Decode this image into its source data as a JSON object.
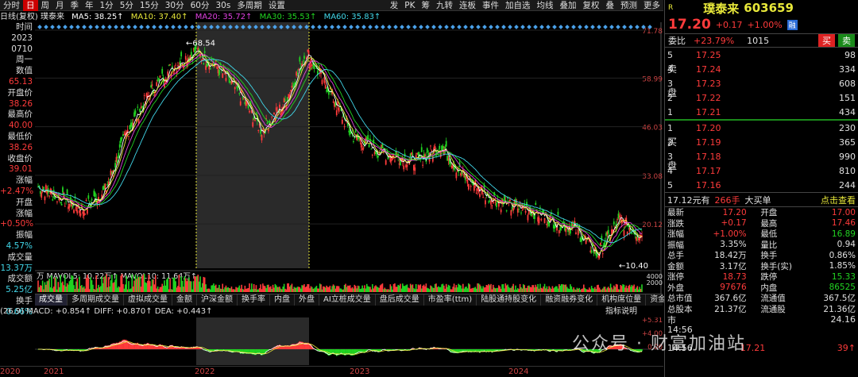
{
  "toolbar": {
    "items": [
      "分时",
      "日",
      "周",
      "月",
      "季",
      "年",
      "1分",
      "5分",
      "15分",
      "30分",
      "60分",
      "30s",
      "多周期",
      "设置"
    ],
    "active_index": 1,
    "right_items": [
      "发",
      "PK",
      "筹",
      "九转",
      "连板",
      "事件",
      "加自选",
      "均线",
      "叠加",
      "复权",
      "叠",
      "预测",
      "更多"
    ]
  },
  "legend": {
    "title": "日线(复权) 璞泰来",
    "ma5": "MA5: 38.25↑",
    "ma10": "MA10: 37.40↑",
    "ma20": "MA20: 35.72↑",
    "ma30": "MA30: 35.53↑",
    "ma60": "MA60: 35.83↑"
  },
  "left_panel": [
    {
      "label": "时间",
      "value": ""
    },
    {
      "label": "2023",
      "value": ""
    },
    {
      "label": "0710",
      "value": ""
    },
    {
      "label": "周一",
      "value": ""
    },
    {
      "label": "数值",
      "value": ""
    },
    {
      "label": "65.13",
      "value": "",
      "cls": "red"
    },
    {
      "label": "开盘价",
      "value": ""
    },
    {
      "label": "38.26",
      "value": "",
      "cls": "red"
    },
    {
      "label": "最高价",
      "value": ""
    },
    {
      "label": "40.00",
      "value": "",
      "cls": "red"
    },
    {
      "label": "最低价",
      "value": ""
    },
    {
      "label": "38.26",
      "value": "",
      "cls": "red"
    },
    {
      "label": "收盘价",
      "value": ""
    },
    {
      "label": "39.01",
      "value": "",
      "cls": "red"
    },
    {
      "label": "涨幅",
      "value": ""
    },
    {
      "label": "+2.47%",
      "value": "",
      "cls": "red"
    },
    {
      "label": "开盘",
      "value": ""
    },
    {
      "label": "涨幅",
      "value": ""
    },
    {
      "label": "+0.50%",
      "value": "",
      "cls": "red"
    },
    {
      "label": "振幅",
      "value": ""
    },
    {
      "label": "4.57%",
      "value": "",
      "cls": "cyan"
    },
    {
      "label": "成交量",
      "value": ""
    },
    {
      "label": "13.37万",
      "value": "",
      "cls": "cyan"
    },
    {
      "label": "成交额",
      "value": ""
    },
    {
      "label": "5.25亿",
      "value": "",
      "cls": "cyan"
    },
    {
      "label": "换手",
      "value": ""
    },
    {
      "label": "0.66%",
      "value": "",
      "cls": "cyan"
    }
  ],
  "price_axis": [
    "71.78",
    "58.99",
    "46.03",
    "33.08",
    "20.12"
  ],
  "annotations": {
    "high": "68.54",
    "low": "10.40"
  },
  "volume_legend": "万 MAVOL5: 10.22万↑ MAVOL10: 11.64万↑",
  "volume_axis": [
    "4000",
    "2000"
  ],
  "tabs": [
    "多周期成交量",
    "虚拟成交量",
    "金额",
    "沪深金额",
    "换手率",
    "内盘",
    "外盘",
    "AI立桩成交量",
    "盘后成交量",
    "市盈率(ttm)",
    "陆股通持股变化",
    "融资融券变化",
    "机构席位量",
    "资金抄底"
  ],
  "tab_prefix": "成交量",
  "macd": {
    "label": "(26,9) MACD: +0.854↑ DIFF: +0.870↑ DEA: +0.443↑",
    "axis": [
      "+5.31",
      "+4.00",
      "0.00"
    ],
    "explain": "指标说明"
  },
  "years": [
    "2020",
    "2021",
    "2022",
    "2023",
    "2024"
  ],
  "right": {
    "header_r": "R",
    "name": "璞泰来",
    "code": "603659",
    "price": "17.20",
    "change": "+0.17",
    "pct": "+1.00%",
    "tag": "融",
    "weibi_label": "委比",
    "weibi": "+23.79%",
    "weicha": "1015",
    "buy_btn": "买",
    "sell_btn": "卖",
    "sell_label": "卖盘",
    "buy_label": "买盘",
    "asks": [
      {
        "lvl": "5",
        "price": "17.25",
        "vol": "98"
      },
      {
        "lvl": "4",
        "price": "17.24",
        "vol": "334"
      },
      {
        "lvl": "3",
        "price": "17.23",
        "vol": "608"
      },
      {
        "lvl": "2",
        "price": "17.22",
        "vol": "151"
      },
      {
        "lvl": "1",
        "price": "17.21",
        "vol": "434"
      }
    ],
    "bids": [
      {
        "lvl": "1",
        "price": "17.20",
        "vol": "230"
      },
      {
        "lvl": "2",
        "price": "17.19",
        "vol": "365"
      },
      {
        "lvl": "3",
        "price": "17.18",
        "vol": "990"
      },
      {
        "lvl": "4",
        "price": "17.17",
        "vol": "810"
      },
      {
        "lvl": "5",
        "price": "17.16",
        "vol": "244"
      }
    ],
    "bigorder": {
      "price": "17.12元有",
      "vol": "266手",
      "label": "大买单",
      "link": "点击查看"
    },
    "stats": [
      [
        "最新",
        "17.20",
        "开盘",
        "17.00"
      ],
      [
        "涨跌",
        "+0.17",
        "最高",
        "17.46"
      ],
      [
        "涨幅",
        "+1.00%",
        "最低",
        "16.89"
      ],
      [
        "振幅",
        "3.35%",
        "量比",
        "0.94"
      ],
      [
        "总手",
        "18.42万",
        "换手",
        "0.86%"
      ],
      [
        "金额",
        "3.17亿",
        "换手(实)",
        "1.85%"
      ],
      [
        "涨停",
        "18.73",
        "跌停",
        "15.33"
      ],
      [
        "外盘",
        "97676",
        "内盘",
        "86525"
      ],
      [
        "总市值",
        "367.6亿",
        "流通值",
        "367.5亿"
      ],
      [
        "总股本",
        "21.37亿",
        "流通股",
        "21.36亿"
      ]
    ],
    "pe_label": "市",
    "pe_val": "24.16",
    "ticks": [
      {
        "time": "14:56",
        "price": "",
        "vol": ""
      },
      {
        "time": "14:56",
        "price": "17.21",
        "vol": "39"
      }
    ]
  },
  "watermark": "公众号 · 财富加油站",
  "colors": {
    "up": "#ff3b3b",
    "down": "#21d321",
    "ma5": "#ffffff",
    "ma10": "#e8e83a",
    "ma20": "#e040e0",
    "ma30": "#21d321",
    "ma60": "#41d6e8"
  },
  "chart_data": {
    "type": "line",
    "title": "璞泰来 日线(复权)",
    "series": [
      {
        "name": "price",
        "x": [
          "2020-01",
          "2020-04",
          "2020-07",
          "2020-10",
          "2021-01",
          "2021-04",
          "2021-07",
          "2021-09",
          "2021-11",
          "2022-01",
          "2022-03",
          "2022-05",
          "2022-07",
          "2022-09",
          "2022-11",
          "2023-01",
          "2023-03",
          "2023-05",
          "2023-07",
          "2023-09",
          "2023-11",
          "2024-01",
          "2024-03",
          "2024-05",
          "2024-07",
          "2024-09",
          "2024-10",
          "2024-11"
        ],
        "values": [
          30,
          27,
          24,
          29,
          45,
          55,
          62,
          66,
          62,
          55,
          45,
          52,
          66,
          56,
          44,
          40,
          38,
          37,
          41,
          33,
          28,
          25,
          24,
          21,
          19,
          12,
          21,
          17
        ]
      }
    ],
    "ylim": [
      10.4,
      71.78
    ]
  }
}
